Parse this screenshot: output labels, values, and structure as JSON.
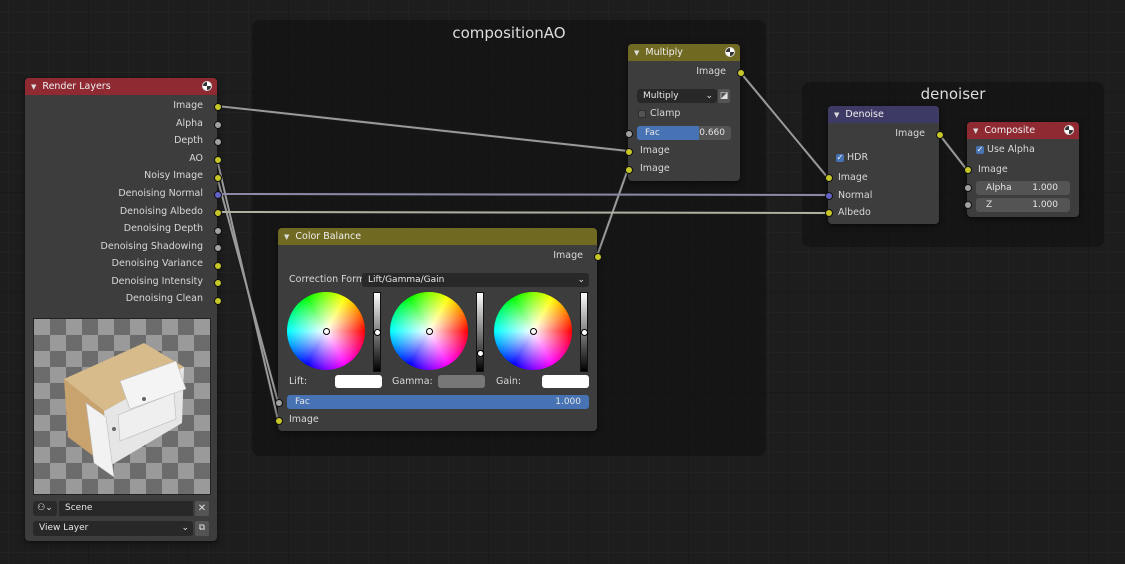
{
  "frames": {
    "composition_ao": "compositionAO",
    "denoiser": "denoiser"
  },
  "render_layers": {
    "title": "Render Layers",
    "header_color": "#8f2a33",
    "outputs": [
      "Image",
      "Alpha",
      "Depth",
      "AO",
      "Noisy Image",
      "Denoising Normal",
      "Denoising Albedo",
      "Denoising Depth",
      "Denoising Shadowing",
      "Denoising Variance",
      "Denoising Intensity",
      "Denoising Clean"
    ],
    "scene_icon": "scene-icon",
    "scene": "Scene",
    "view_layer": "View Layer"
  },
  "multiply": {
    "title": "Multiply",
    "header_color": "#706922",
    "output": "Image",
    "blend_mode": "Multiply",
    "clamp_label": "Clamp",
    "clamp_checked": false,
    "fac_label": "Fac",
    "fac_value": "0.660",
    "inputs": [
      "Image",
      "Image"
    ]
  },
  "color_balance": {
    "title": "Color Balance",
    "header_color": "#706922",
    "output": "Image",
    "correction_label": "Correction Form...",
    "correction_value": "Lift/Gamma/Gain",
    "lift_label": "Lift:",
    "gamma_label": "Gamma:",
    "gain_label": "Gain:",
    "fac_label": "Fac",
    "fac_value": "1.000",
    "input": "Image"
  },
  "denoise": {
    "title": "Denoise",
    "header_color": "#3e3a66",
    "output": "Image",
    "hdr_label": "HDR",
    "hdr_checked": true,
    "inputs": [
      "Image",
      "Normal",
      "Albedo"
    ]
  },
  "composite": {
    "title": "Composite",
    "header_color": "#8f2a33",
    "use_alpha_label": "Use Alpha",
    "use_alpha_checked": true,
    "image_label": "Image",
    "alpha_label": "Alpha",
    "alpha_value": "1.000",
    "z_label": "Z",
    "z_value": "1.000"
  }
}
